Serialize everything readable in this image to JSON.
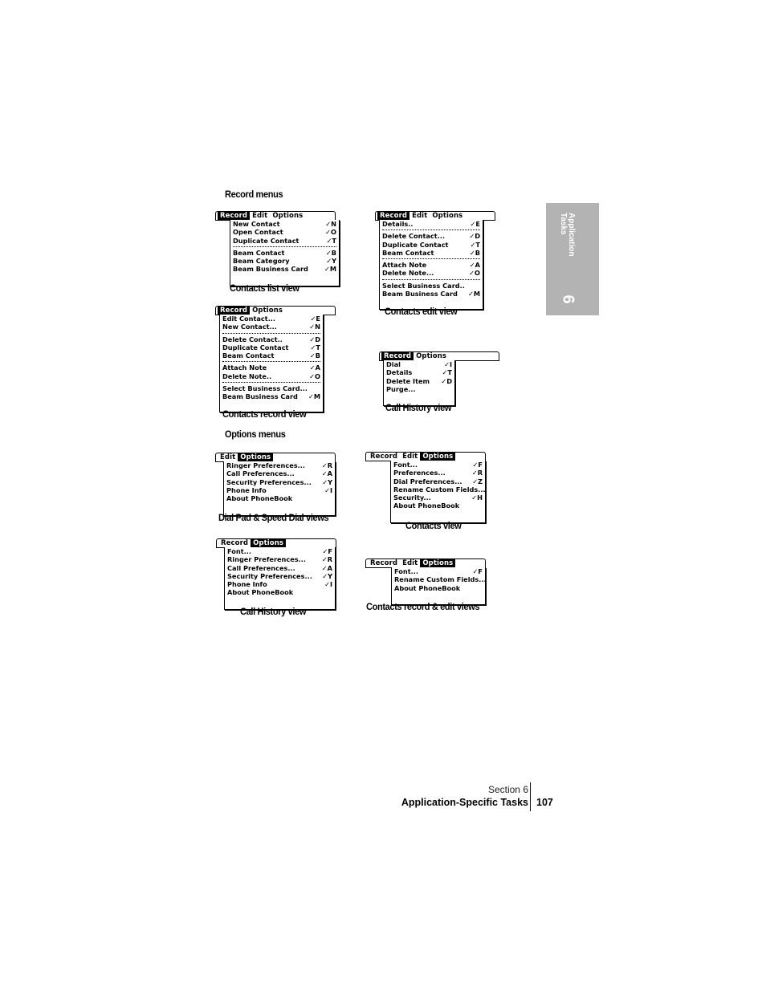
{
  "headings": {
    "record_menus": "Record menus",
    "options_menus": "Options menus"
  },
  "menus": {
    "contacts_list": {
      "caption": "Contacts list view",
      "titles": [
        {
          "label": "Record",
          "active": true
        },
        {
          "label": "Edit",
          "active": false
        },
        {
          "label": "Options",
          "active": false
        }
      ],
      "groups": [
        [
          {
            "label": "New Contact",
            "shortcut": "✓N"
          },
          {
            "label": "Open Contact",
            "shortcut": "✓O"
          },
          {
            "label": "Duplicate Contact",
            "shortcut": "✓T"
          }
        ],
        [
          {
            "label": "Beam Contact",
            "shortcut": "✓B"
          },
          {
            "label": "Beam Category",
            "shortcut": "✓Y"
          },
          {
            "label": "Beam Business Card",
            "shortcut": "✓M"
          }
        ]
      ]
    },
    "contacts_edit": {
      "caption": "Contacts edit view",
      "titles": [
        {
          "label": "Record",
          "active": true
        },
        {
          "label": "Edit",
          "active": false
        },
        {
          "label": "Options",
          "active": false
        }
      ],
      "groups": [
        [
          {
            "label": "Details..",
            "shortcut": "✓E"
          }
        ],
        [
          {
            "label": "Delete Contact...",
            "shortcut": "✓D"
          },
          {
            "label": "Duplicate Contact",
            "shortcut": "✓T"
          },
          {
            "label": "Beam Contact",
            "shortcut": "✓B"
          }
        ],
        [
          {
            "label": "Attach Note",
            "shortcut": "✓A"
          },
          {
            "label": "Delete Note...",
            "shortcut": "✓O"
          }
        ],
        [
          {
            "label": "Select Business Card..",
            "shortcut": ""
          },
          {
            "label": "Beam Business Card",
            "shortcut": "✓M"
          }
        ]
      ]
    },
    "contacts_record": {
      "caption": "Contacts record view",
      "titles": [
        {
          "label": "Record",
          "active": true
        },
        {
          "label": "Options",
          "active": false
        }
      ],
      "groups": [
        [
          {
            "label": "Edit Contact...",
            "shortcut": "✓E"
          },
          {
            "label": "New Contact...",
            "shortcut": "✓N"
          }
        ],
        [
          {
            "label": "Delete Contact..",
            "shortcut": "✓D"
          },
          {
            "label": "Duplicate Contact",
            "shortcut": "✓T"
          },
          {
            "label": "Beam Contact",
            "shortcut": "✓B"
          }
        ],
        [
          {
            "label": "Attach Note",
            "shortcut": "✓A"
          },
          {
            "label": "Delete Note..",
            "shortcut": "✓O"
          }
        ],
        [
          {
            "label": "Select Business Card...",
            "shortcut": ""
          },
          {
            "label": "Beam Business Card",
            "shortcut": "✓M"
          }
        ]
      ]
    },
    "call_history_record": {
      "caption": "Call History view",
      "titles": [
        {
          "label": "Record",
          "active": true
        },
        {
          "label": "Options",
          "active": false
        }
      ],
      "groups": [
        [
          {
            "label": "Dial",
            "shortcut": "✓I"
          },
          {
            "label": "Details",
            "shortcut": "✓T"
          },
          {
            "label": "Delete Item",
            "shortcut": "✓D"
          },
          {
            "label": "Purge...",
            "shortcut": ""
          }
        ]
      ]
    },
    "dial_pad_options": {
      "caption": "Dial Pad & Speed Dial views",
      "titles": [
        {
          "label": "Edit",
          "active": false
        },
        {
          "label": "Options",
          "active": true
        }
      ],
      "groups": [
        [
          {
            "label": "Ringer Preferences...",
            "shortcut": "✓R"
          },
          {
            "label": "Call Preferences...",
            "shortcut": "✓A"
          },
          {
            "label": "Security Preferences...",
            "shortcut": "✓Y"
          },
          {
            "label": "Phone Info",
            "shortcut": "✓I"
          },
          {
            "label": "About PhoneBook",
            "shortcut": ""
          }
        ]
      ]
    },
    "contacts_options": {
      "caption": "Contacts view",
      "titles": [
        {
          "label": "Record",
          "active": false
        },
        {
          "label": "Edit",
          "active": false
        },
        {
          "label": "Options",
          "active": true
        }
      ],
      "groups": [
        [
          {
            "label": "Font...",
            "shortcut": "✓F"
          },
          {
            "label": "Preferences...",
            "shortcut": "✓R"
          },
          {
            "label": "Dial Preferences...",
            "shortcut": "✓Z"
          },
          {
            "label": "Rename Custom Fields...",
            "shortcut": ""
          },
          {
            "label": "Security...",
            "shortcut": "✓H"
          },
          {
            "label": "About PhoneBook",
            "shortcut": ""
          }
        ]
      ]
    },
    "call_history_options": {
      "caption": "Call History view",
      "titles": [
        {
          "label": "Record",
          "active": false
        },
        {
          "label": "Options",
          "active": true
        }
      ],
      "groups": [
        [
          {
            "label": "Font...",
            "shortcut": "✓F"
          },
          {
            "label": "Ringer Preferences...",
            "shortcut": "✓R"
          },
          {
            "label": "Call Preferences...",
            "shortcut": "✓A"
          },
          {
            "label": "Security Preferences...",
            "shortcut": "✓Y"
          },
          {
            "label": "Phone Info",
            "shortcut": "✓I"
          },
          {
            "label": "About PhoneBook",
            "shortcut": ""
          }
        ]
      ]
    },
    "contacts_record_edit_options": {
      "caption": "Contacts record & edit views",
      "titles": [
        {
          "label": "Record",
          "active": false
        },
        {
          "label": "Edit",
          "active": false
        },
        {
          "label": "Options",
          "active": true
        }
      ],
      "groups": [
        [
          {
            "label": "Font...",
            "shortcut": "✓F"
          },
          {
            "label": "Rename Custom Fields...",
            "shortcut": ""
          },
          {
            "label": "About PhoneBook",
            "shortcut": ""
          }
        ]
      ]
    }
  },
  "side_tab": {
    "text_line1": "Application",
    "text_line2": "Tasks",
    "number": "6",
    "color": "#b3b3b3"
  },
  "footer": {
    "section": "Section 6",
    "title": "Application-Specific Tasks",
    "page": "107"
  }
}
